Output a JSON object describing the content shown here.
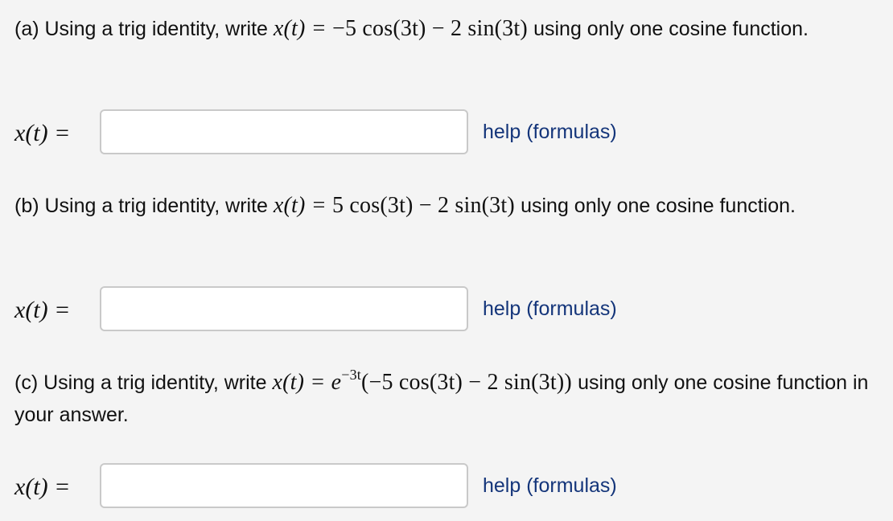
{
  "parts": [
    {
      "intro": "(a) Using a trig identity, write",
      "expression": {
        "lhs": "x(t) = ",
        "rhs": "−5 cos(3t) − 2 sin(3t)",
        "exp": ""
      },
      "outro": " using only one cosine function.",
      "answer_label": "x(t) =",
      "answer_value": "",
      "help_link": "help (formulas)"
    },
    {
      "intro": "(b) Using a trig identity, write",
      "expression": {
        "lhs": "x(t) = ",
        "rhs": "5 cos(3t) − 2 sin(3t)",
        "exp": ""
      },
      "outro": " using only one cosine function.",
      "answer_label": "x(t) =",
      "answer_value": "",
      "help_link": "help (formulas)"
    },
    {
      "intro": "(c) Using a trig identity, write",
      "expression": {
        "lhs": "x(t) = e",
        "exp": "−3t",
        "rhs": "(−5 cos(3t) − 2 sin(3t))"
      },
      "outro": " using only one cosine function in your answer.",
      "answer_label": "x(t) =",
      "answer_value": "",
      "help_link": "help (formulas)"
    }
  ]
}
